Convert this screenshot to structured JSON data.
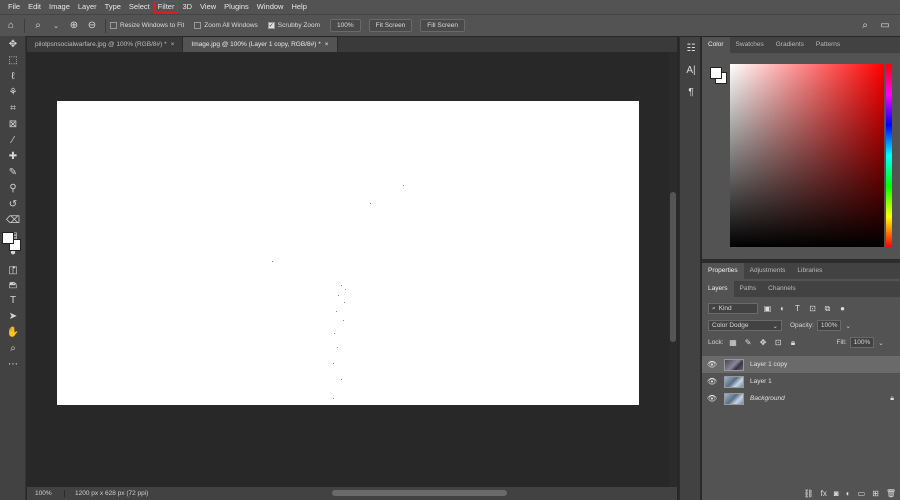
{
  "menubar": {
    "items": [
      "File",
      "Edit",
      "Image",
      "Layer",
      "Type",
      "Select",
      "Filter",
      "3D",
      "View",
      "Plugins",
      "Window",
      "Help"
    ],
    "highlighted": "Filter",
    "highlight_color": "#e02020"
  },
  "options": {
    "resize_windows": "Resize Windows to Fit",
    "zoom_all_windows": "Zoom All Windows",
    "scrubby_zoom": "Scrubby Zoom",
    "zoom_value": "100%",
    "fit_screen": "Fit Screen",
    "fill_screen": "Fill Screen"
  },
  "tabs": [
    {
      "label": "pilotpsnsocialwarfare.jpg @ 100% (RGB/8#) *",
      "close": "×"
    },
    {
      "label": "Image.jpg @ 100% (Layer 1 copy, RGB/8#) *",
      "close": "×"
    }
  ],
  "status": {
    "zoom": "100%",
    "doc_info": "1200 px x 628 px (72 ppi)"
  },
  "color_panel": {
    "tabs": [
      "Color",
      "Swatches",
      "Gradients",
      "Patterns"
    ]
  },
  "properties_tabs": [
    "Properties",
    "Adjustments",
    "Libraries"
  ],
  "layers_panel": {
    "tabs": [
      "Layers",
      "Paths",
      "Channels"
    ],
    "filter_kind": "Kind",
    "blend_mode": "Color Dodge",
    "opacity_label": "Opacity:",
    "opacity_value": "100%",
    "lock_label": "Lock:",
    "fill_label": "Fill:",
    "fill_value": "100%",
    "layers": [
      {
        "name": "Layer 1 copy"
      },
      {
        "name": "Layer 1"
      },
      {
        "name": "Background"
      }
    ]
  }
}
